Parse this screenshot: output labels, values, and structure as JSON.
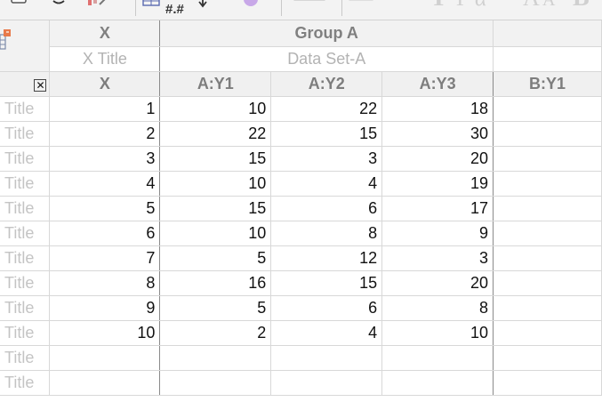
{
  "table": {
    "group_header": {
      "x": "X",
      "group": "Group A"
    },
    "titles": {
      "x": "X Title",
      "group": "Data Set-A"
    },
    "close_label": "✕",
    "columns": [
      "X",
      "A:Y1",
      "A:Y2",
      "A:Y3",
      "B:Y1"
    ],
    "row_label": "Title",
    "rows": [
      {
        "x": "1",
        "y1": "10",
        "y2": "22",
        "y3": "18"
      },
      {
        "x": "2",
        "y1": "22",
        "y2": "15",
        "y3": "30"
      },
      {
        "x": "3",
        "y1": "15",
        "y2": "3",
        "y3": "20"
      },
      {
        "x": "4",
        "y1": "10",
        "y2": "4",
        "y3": "19"
      },
      {
        "x": "5",
        "y1": "15",
        "y2": "6",
        "y3": "17"
      },
      {
        "x": "6",
        "y1": "10",
        "y2": "8",
        "y3": "9"
      },
      {
        "x": "7",
        "y1": "5",
        "y2": "12",
        "y3": "3"
      },
      {
        "x": "8",
        "y1": "16",
        "y2": "15",
        "y3": "20"
      },
      {
        "x": "9",
        "y1": "5",
        "y2": "6",
        "y3": "8"
      },
      {
        "x": "10",
        "y1": "2",
        "y2": "4",
        "y3": "10"
      },
      {
        "x": "",
        "y1": "",
        "y2": "",
        "y3": ""
      },
      {
        "x": "",
        "y1": "",
        "y2": "",
        "y3": ""
      }
    ]
  },
  "toolbar": {
    "numformat_label": "#.#",
    "icons": [
      "checkbox-icon",
      "undo-icon",
      "chart-icon",
      "table-format-icon",
      "sort-arrow-icon",
      "circle-icon",
      "font-format-icon"
    ]
  }
}
